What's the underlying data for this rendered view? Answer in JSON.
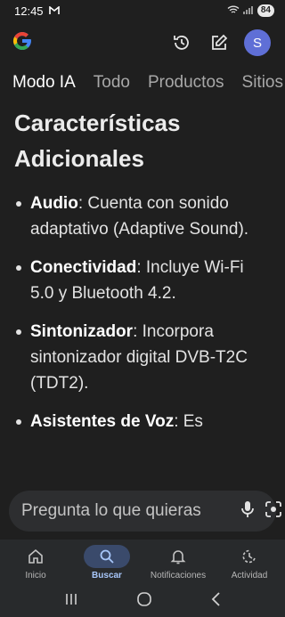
{
  "status_bar": {
    "time": "12:45",
    "battery": "84"
  },
  "header": {
    "avatar_letter": "S"
  },
  "tabs": [
    {
      "label": "Modo IA"
    },
    {
      "label": "Todo"
    },
    {
      "label": "Productos"
    },
    {
      "label": "Sitios"
    }
  ],
  "content": {
    "heading": "Características Adicionales",
    "features": [
      {
        "term": "Audio",
        "text": ": Cuenta con sonido adaptativo (Adaptive Sound)."
      },
      {
        "term": "Conectividad",
        "text": ": Incluye Wi-Fi 5.0 y Bluetooth 4.2."
      },
      {
        "term": "Sintonizador",
        "text": ": Incorpora sintonizador digital DVB-T2C (TDT2)."
      },
      {
        "term": "Asistentes de Voz",
        "text": ": Es"
      }
    ]
  },
  "ask_bar": {
    "placeholder": "Pregunta lo que quieras"
  },
  "bottom_nav": [
    {
      "label": "Inicio"
    },
    {
      "label": "Buscar"
    },
    {
      "label": "Notificaciones"
    },
    {
      "label": "Actividad"
    }
  ],
  "colors": {
    "background": "#1f1f1f",
    "accent": "#a8c7fa",
    "avatar": "#5f6fd6"
  }
}
